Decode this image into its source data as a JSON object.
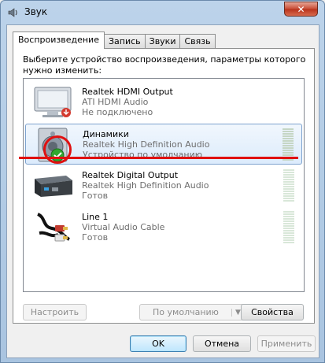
{
  "window": {
    "title": "Звук"
  },
  "tabs": [
    {
      "label": "Воспроизведение",
      "active": true
    },
    {
      "label": "Запись",
      "active": false
    },
    {
      "label": "Звуки",
      "active": false
    },
    {
      "label": "Связь",
      "active": false
    }
  ],
  "instruction": "Выберите устройство воспроизведения, параметры которого нужно изменить:",
  "devices": [
    {
      "name": "Realtek HDMI Output",
      "driver": "ATI HDMI Audio",
      "status": "Не подключено",
      "icon": "monitor-icon"
    },
    {
      "name": "Динамики",
      "driver": "Realtek High Definition Audio",
      "status": "Устройство по умолчанию",
      "icon": "speaker-icon",
      "selected": true
    },
    {
      "name": "Realtek Digital Output",
      "driver": "Realtek High Definition Audio",
      "status": "Готов",
      "icon": "digital-output-icon"
    },
    {
      "name": "Line 1",
      "driver": "Virtual Audio Cable",
      "status": "Готов",
      "icon": "cable-icon"
    }
  ],
  "buttons": {
    "configure": "Настроить",
    "set_default": "По умолчанию",
    "properties": "Свойства",
    "ok": "OK",
    "cancel": "Отмена",
    "apply": "Применить"
  },
  "colors": {
    "annotation": "#e01010",
    "selected_bg": "#dcebfc",
    "default_check": "#2fa82f"
  }
}
